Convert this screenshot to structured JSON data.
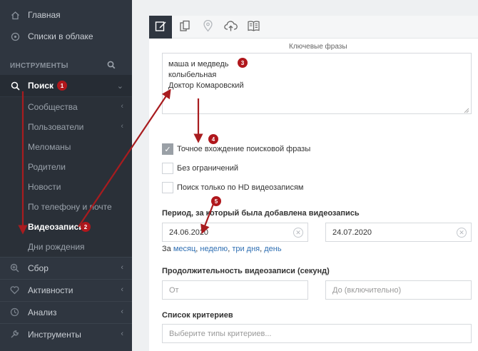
{
  "sidebar": {
    "items_top": [
      "Главная",
      "Списки в облаке"
    ],
    "section_title": "ИНСТРУМЕНТЫ",
    "search_item": "Поиск",
    "sub_items": [
      "Сообщества",
      "Пользователи",
      "Меломаны",
      "Родители",
      "Новости",
      "По телефону и почте",
      "Видеозаписи",
      "Дни рождения"
    ],
    "bottom_items": [
      "Сбор",
      "Активности",
      "Анализ",
      "Инструменты"
    ]
  },
  "badges": [
    "1",
    "2",
    "3",
    "4",
    "5"
  ],
  "keywords": {
    "caption": "Ключевые фразы",
    "lines": [
      "маша и медведь",
      "колыбельная",
      "Доктор Комаровский"
    ]
  },
  "options": {
    "exact": "Точное вхождение поисковой фразы",
    "no_limit": "Без ограничений",
    "hd_only": "Поиск только по HD видеозаписям"
  },
  "period": {
    "label": "Период, за который была добавлена видеозапись",
    "from": "24.06.2020",
    "to": "24.07.2020",
    "prefix": "За",
    "links": [
      "месяц",
      "неделю",
      "три дня",
      "день"
    ]
  },
  "duration": {
    "label": "Продолжительность видеозаписи (секунд)",
    "from_placeholder": "От",
    "to_placeholder": "До (включительно)"
  },
  "criteria": {
    "label": "Список критериев",
    "placeholder": "Выберите типы критериев..."
  },
  "colors": {
    "sidebar": "#2f3640",
    "badge": "#b0171c",
    "arrow": "#a81c1f",
    "link": "#2f6fb3"
  }
}
